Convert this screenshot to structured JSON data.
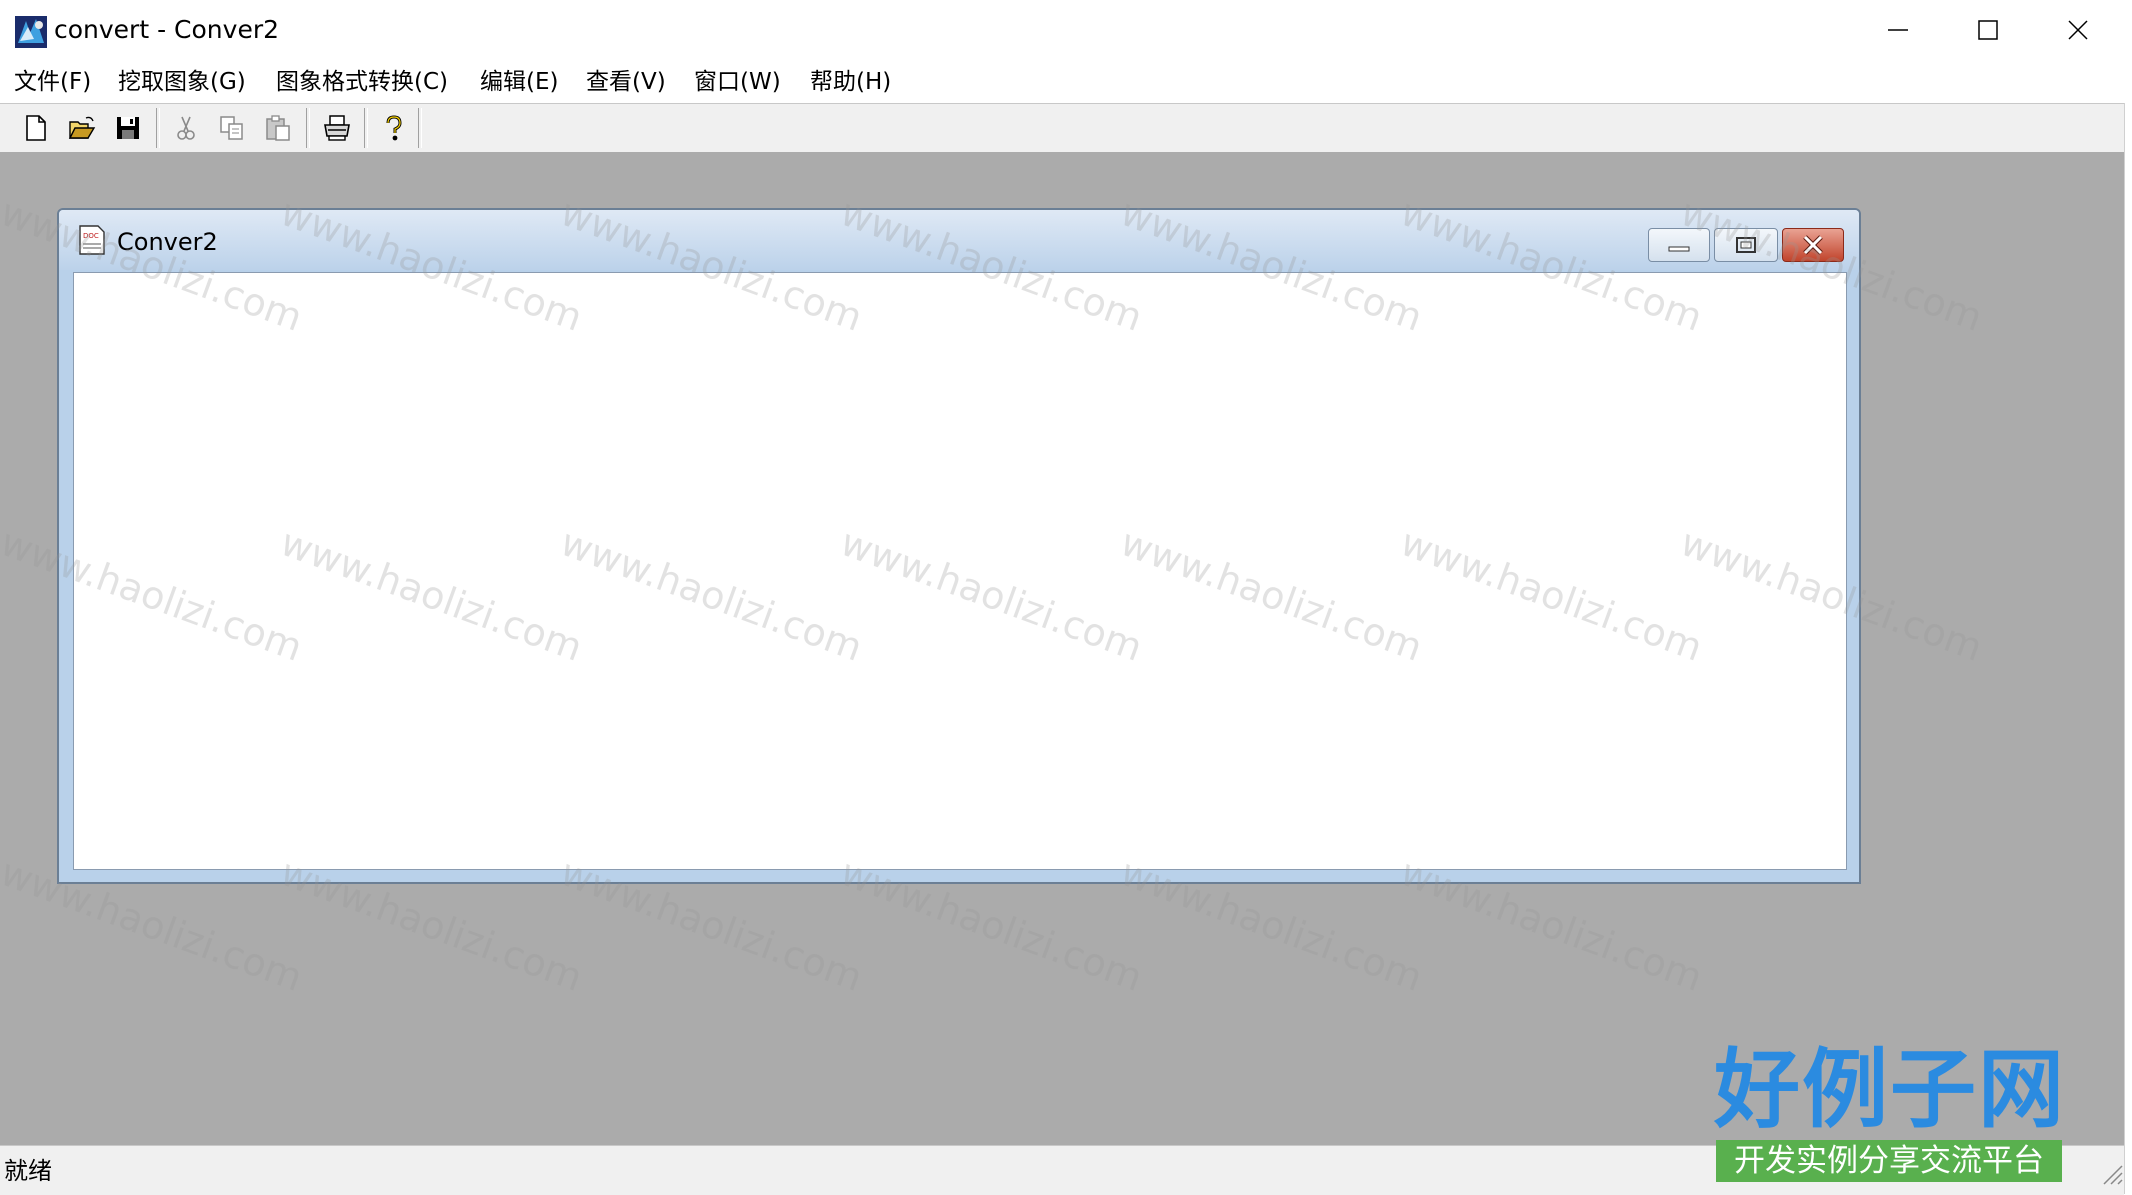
{
  "window": {
    "title": "convert - Conver2",
    "controls": [
      "minimize-icon",
      "maximize-icon",
      "close-icon"
    ]
  },
  "menu": [
    {
      "label": "文件(F)"
    },
    {
      "label": "挖取图象(G)"
    },
    {
      "label": "图象格式转换(C)"
    },
    {
      "label": "编辑(E)"
    },
    {
      "label": "查看(V)"
    },
    {
      "label": "窗口(W)"
    },
    {
      "label": "帮助(H)"
    }
  ],
  "toolbar": {
    "buttons": [
      {
        "icon": "new-file-icon",
        "enabled": true
      },
      {
        "icon": "open-folder-icon",
        "enabled": true
      },
      {
        "icon": "save-icon",
        "enabled": true
      },
      {
        "icon": "cut-icon",
        "enabled": false
      },
      {
        "icon": "copy-icon",
        "enabled": false
      },
      {
        "icon": "paste-icon",
        "enabled": false
      },
      {
        "icon": "print-icon",
        "enabled": true
      },
      {
        "icon": "help-icon",
        "enabled": true
      }
    ]
  },
  "child_window": {
    "title": "Conver2",
    "icon": "document-icon",
    "controls": [
      "minimize-icon",
      "restore-icon",
      "close-icon"
    ]
  },
  "status": {
    "text": "就绪"
  },
  "watermark": {
    "text": "www.haolizi.com"
  },
  "brand": {
    "title": "好例子网",
    "subtitle": "开发实例分享交流平台"
  },
  "colors": {
    "mdi_background": "#ababab",
    "child_frame": "#b9d1ea",
    "close_button": "#c1442c",
    "brand_blue": "#2b8be0",
    "brand_green": "#59b04e"
  }
}
